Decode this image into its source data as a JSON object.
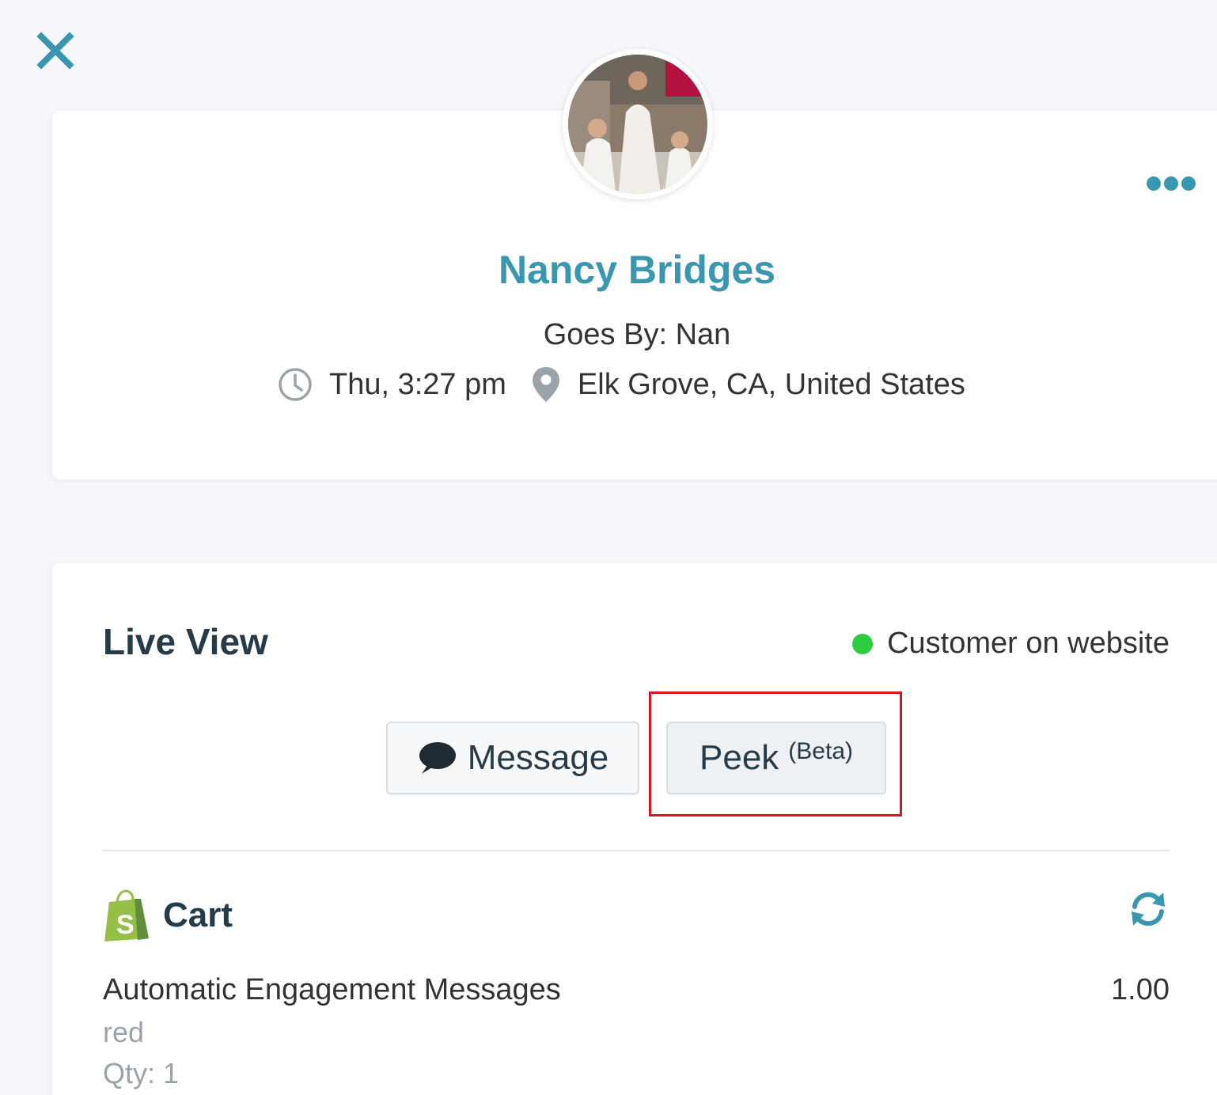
{
  "colors": {
    "accent": "#3a97b0",
    "heading": "#263b4a",
    "online_status": "#2ecc40",
    "highlight": "#e0141e",
    "muted_text": "#9aa3aa"
  },
  "header": {
    "close_icon": "close-x-icon"
  },
  "profile": {
    "avatar_icon": "customer-photo",
    "more_icon": "more-dots-icon",
    "name": "Nancy Bridges",
    "goes_by": "Goes By: Nan",
    "local_time": "Thu, 3:27 pm",
    "location": "Elk Grove, CA, United States"
  },
  "live_view": {
    "title": "Live View",
    "status_text": "Customer on website",
    "message_button_label": "Message",
    "peek_button_label": "Peek",
    "peek_badge": "(Beta)"
  },
  "cart": {
    "title": "Cart",
    "platform_icon": "shopify-bag-icon",
    "refresh_icon": "refresh-icon",
    "items": [
      {
        "name": "Automatic Engagement Messages",
        "variant": "red",
        "qty": "Qty: 1",
        "price": "1.00"
      }
    ]
  }
}
